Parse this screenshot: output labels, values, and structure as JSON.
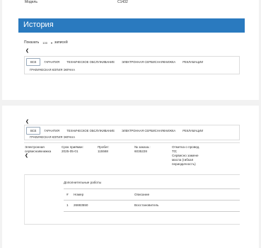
{
  "top": {
    "model_label": "Модель",
    "model_value": "C1432",
    "history_title": "История",
    "show_label": "Показать",
    "show_value": "100",
    "show_suffix": "записей",
    "tabs": [
      "ВСЕ",
      "ГАРАНТИЯ",
      "ТЕХНИЧЕСКОЕ ОБСЛУЖИВАНИЕ",
      "ЭЛЕКТРОННАЯ СЕРВИСНАЯКНИЖКА",
      "РЕКЛАМАЦИИ"
    ],
    "tab_overflow": "ГРАФИЧЕСКАЯ КОПИЯ ЭКРАНА"
  },
  "bottom": {
    "tabs": [
      "ВСЕ",
      "ГАРАНТИЯ",
      "ТЕХНИЧЕСКОЕ ОБСЛУЖИВАНИЕ",
      "ЭЛЕКТРОННАЯ СЕРВИСНАЯКНИЖКА",
      "РЕКЛАМАЦИИ"
    ],
    "tab_overflow": "ГРАФИЧЕСКАЯ КОПИЯ ЭКРАНА",
    "record": {
      "type_line1": "Электронная",
      "type_line2": "сервиснаякнижка",
      "date_label": "Срок приёмки:",
      "date_value": "2025-05-01",
      "mileage_label": "Пробег:",
      "mileage_value": "115568",
      "order_label": "№ заказа.:",
      "order_value": "6035228",
      "note_line1": "Отметка о провед.",
      "note_line2": "ТО;",
      "note_line3": "Сервисно замене",
      "note_line4": "масла (гибкая",
      "note_line5": "периодичность)"
    },
    "extra_title": "Дополнительные работы",
    "table": {
      "headers": [
        "#",
        "Номер",
        "Описание"
      ],
      "rows": [
        [
          "1",
          "26883550",
          "Восстановитель"
        ]
      ]
    }
  }
}
